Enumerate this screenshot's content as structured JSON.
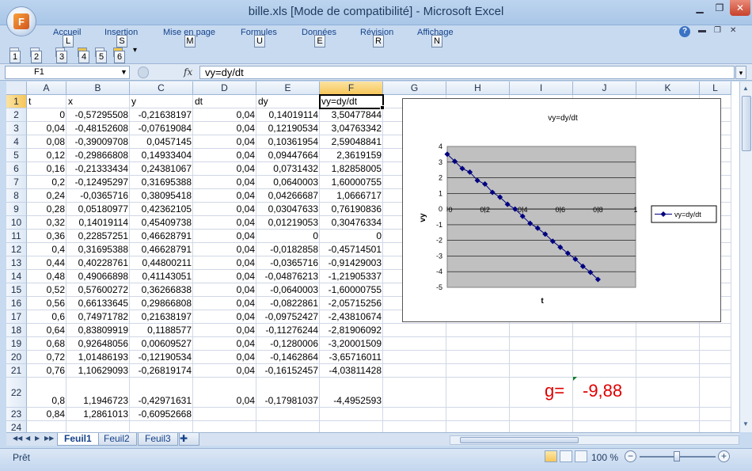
{
  "window": {
    "title": "bille.xls  [Mode de compatibilité] - Microsoft Excel",
    "minimize_icon": "minimize-icon",
    "maximize_icon": "restore-icon",
    "close_icon": "close-icon"
  },
  "ribbon": {
    "tabs": [
      {
        "label": "Accueil",
        "keytip": "L"
      },
      {
        "label": "Insertion",
        "keytip": "S"
      },
      {
        "label": "Mise en page",
        "keytip": "M"
      },
      {
        "label": "Formules",
        "keytip": "U"
      },
      {
        "label": "Données",
        "keytip": "E"
      },
      {
        "label": "Révision",
        "keytip": "R"
      },
      {
        "label": "Affichage",
        "keytip": "N"
      }
    ]
  },
  "qat": {
    "keytips": [
      "1",
      "2",
      "3",
      "4",
      "5",
      "6"
    ]
  },
  "formula_bar": {
    "name_box": "F1",
    "fx": "fx",
    "formula": "vy=dy/dt"
  },
  "columns": [
    "A",
    "B",
    "C",
    "D",
    "E",
    "F",
    "G",
    "H",
    "I",
    "J",
    "K",
    "L"
  ],
  "rows": [
    [
      "t",
      "x",
      "y",
      "dt",
      "dy",
      "vy=dy/dt"
    ],
    [
      "0",
      "-0,57295508",
      "-0,21638197",
      "0,04",
      "0,14019114",
      "3,50477844"
    ],
    [
      "0,04",
      "-0,48152608",
      "-0,07619084",
      "0,04",
      "0,12190534",
      "3,04763342"
    ],
    [
      "0,08",
      "-0,39009708",
      "0,0457145",
      "0,04",
      "0,10361954",
      "2,59048841"
    ],
    [
      "0,12",
      "-0,29866808",
      "0,14933404",
      "0,04",
      "0,09447664",
      "2,3619159"
    ],
    [
      "0,16",
      "-0,21333434",
      "0,24381067",
      "0,04",
      "0,0731432",
      "1,82858005"
    ],
    [
      "0,2",
      "-0,12495297",
      "0,31695388",
      "0,04",
      "0,0640003",
      "1,60000755"
    ],
    [
      "0,24",
      "-0,0365716",
      "0,38095418",
      "0,04",
      "0,04266687",
      "1,0666717"
    ],
    [
      "0,28",
      "0,05180977",
      "0,42362105",
      "0,04",
      "0,03047633",
      "0,76190836"
    ],
    [
      "0,32",
      "0,14019114",
      "0,45409738",
      "0,04",
      "0,01219053",
      "0,30476334"
    ],
    [
      "0,36",
      "0,22857251",
      "0,46628791",
      "0,04",
      "0",
      "0"
    ],
    [
      "0,4",
      "0,31695388",
      "0,46628791",
      "0,04",
      "-0,0182858",
      "-0,45714501"
    ],
    [
      "0,44",
      "0,40228761",
      "0,44800211",
      "0,04",
      "-0,0365716",
      "-0,91429003"
    ],
    [
      "0,48",
      "0,49066898",
      "0,41143051",
      "0,04",
      "-0,04876213",
      "-1,21905337"
    ],
    [
      "0,52",
      "0,57600272",
      "0,36266838",
      "0,04",
      "-0,0640003",
      "-1,60000755"
    ],
    [
      "0,56",
      "0,66133645",
      "0,29866808",
      "0,04",
      "-0,0822861",
      "-2,05715256"
    ],
    [
      "0,6",
      "0,74971782",
      "0,21638197",
      "0,04",
      "-0,09752427",
      "-2,43810674"
    ],
    [
      "0,64",
      "0,83809919",
      "0,1188577",
      "0,04",
      "-0,11276244",
      "-2,81906092"
    ],
    [
      "0,68",
      "0,92648056",
      "0,00609527",
      "0,04",
      "-0,1280006",
      "-3,20001509"
    ],
    [
      "0,72",
      "1,01486193",
      "-0,12190534",
      "0,04",
      "-0,1462864",
      "-3,65716011"
    ],
    [
      "0,76",
      "1,10629093",
      "-0,26819174",
      "0,04",
      "-0,16152457",
      "-4,03811428"
    ],
    [
      "0,8",
      "1,1946723",
      "-0,42971631",
      "0,04",
      "-0,17981037",
      "-4,4952593"
    ],
    [
      "0,84",
      "1,2861013",
      "-0,60952668",
      "",
      "",
      ""
    ],
    [
      "",
      "",
      "",
      "",
      "",
      ""
    ]
  ],
  "g_label": "g=",
  "g_value": "-9,88",
  "chart_data": {
    "type": "line",
    "title": "vy=dy/dt",
    "xlabel": "t",
    "ylabel": "vy",
    "xlim": [
      0,
      1
    ],
    "ylim": [
      -5,
      4
    ],
    "x_ticks": [
      "0",
      "0,2",
      "0,4",
      "0,6",
      "0,8",
      "1"
    ],
    "y_ticks": [
      "4",
      "3",
      "2",
      "1",
      "0",
      "-1",
      "-2",
      "-3",
      "-4",
      "-5"
    ],
    "grid": true,
    "legend_position": "right",
    "plot_background": "#c0c0c0",
    "series_color": "#000080",
    "series": [
      {
        "name": "vy=dy/dt",
        "x": [
          0,
          0.04,
          0.08,
          0.12,
          0.16,
          0.2,
          0.24,
          0.28,
          0.32,
          0.36,
          0.4,
          0.44,
          0.48,
          0.52,
          0.56,
          0.6,
          0.64,
          0.68,
          0.72,
          0.76,
          0.8
        ],
        "values": [
          3.50477844,
          3.04763342,
          2.59048841,
          2.3619159,
          1.82858005,
          1.60000755,
          1.0666717,
          0.76190836,
          0.30476334,
          0,
          -0.45714501,
          -0.91429003,
          -1.21905337,
          -1.60000755,
          -2.05715256,
          -2.43810674,
          -2.81906092,
          -3.20001509,
          -3.65716011,
          -4.03811428,
          -4.4952593
        ]
      }
    ]
  },
  "sheet_tabs": [
    "Feuil1",
    "Feuil2",
    "Feuil3"
  ],
  "status": {
    "text": "Prêt",
    "zoom": "100 %",
    "zoom_minus": "−",
    "zoom_plus": "+"
  }
}
